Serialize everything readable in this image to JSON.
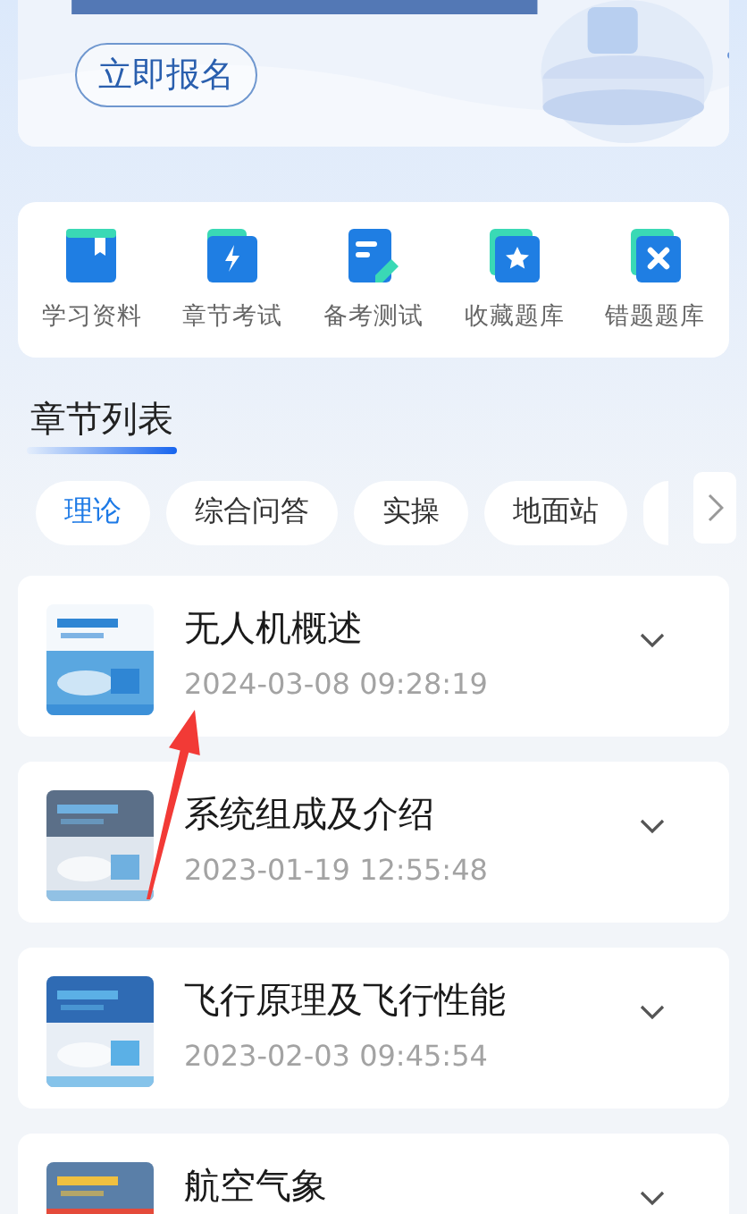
{
  "banner": {
    "button": "立即报名"
  },
  "shortcuts": [
    "学习资料",
    "章节考试",
    "备考测试",
    "收藏题库",
    "错题题库"
  ],
  "section_title": "章节列表",
  "tabs": [
    {
      "label": "理论",
      "selected": true
    },
    {
      "label": "综合问答",
      "selected": false
    },
    {
      "label": "实操",
      "selected": false
    },
    {
      "label": "地面站",
      "selected": false
    }
  ],
  "chapters": [
    {
      "title": "无人机概述",
      "date": "2024-03-08 09:28:19"
    },
    {
      "title": "系统组成及介绍",
      "date": "2023-01-19 12:55:48"
    },
    {
      "title": "飞行原理及飞行性能",
      "date": "2023-02-03 09:45:54"
    },
    {
      "title": "航空气象"
    }
  ]
}
